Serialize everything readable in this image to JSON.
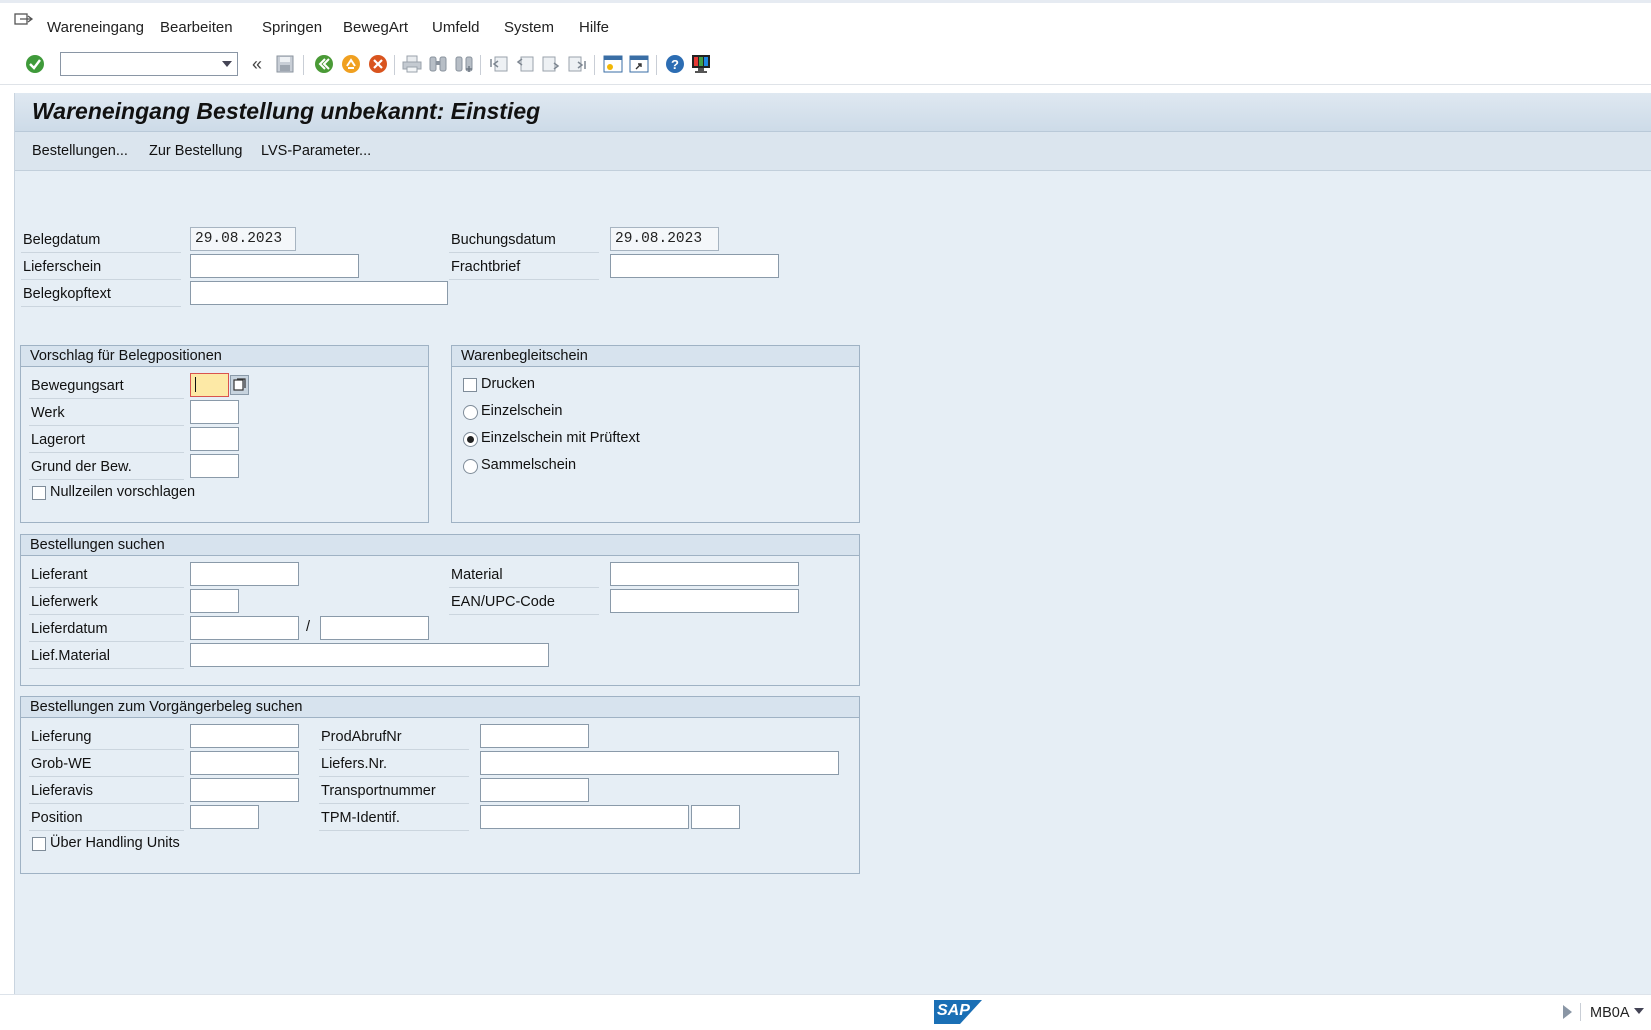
{
  "menu": {
    "items": [
      "Wareneingang",
      "Bearbeiten",
      "Springen",
      "BewegArt",
      "Umfeld",
      "System",
      "Hilfe"
    ]
  },
  "toolbar": {
    "command_value": ""
  },
  "title": "Wareneingang Bestellung unbekannt: Einstieg",
  "app_toolbar": {
    "items": [
      "Bestellungen...",
      "Zur Bestellung",
      "LVS-Parameter..."
    ]
  },
  "header": {
    "belegdatum_label": "Belegdatum",
    "belegdatum_value": "29.08.2023",
    "lieferschein_label": "Lieferschein",
    "lieferschein_value": "",
    "belegkopftext_label": "Belegkopftext",
    "belegkopftext_value": "",
    "buchungsdatum_label": "Buchungsdatum",
    "buchungsdatum_value": "29.08.2023",
    "frachtbrief_label": "Frachtbrief",
    "frachtbrief_value": ""
  },
  "vorschlag": {
    "title": "Vorschlag für Belegpositionen",
    "bewegungsart_label": "Bewegungsart",
    "bewegungsart_value": "",
    "werk_label": "Werk",
    "lagerort_label": "Lagerort",
    "grund_label": "Grund der Bew.",
    "nullzeilen_label": "Nullzeilen vorschlagen",
    "nullzeilen_checked": false
  },
  "warenbegleitschein": {
    "title": "Warenbegleitschein",
    "drucken_label": "Drucken",
    "drucken_checked": false,
    "options": [
      "Einzelschein",
      "Einzelschein mit Prüftext",
      "Sammelschein"
    ],
    "selected_option": "Einzelschein mit Prüftext"
  },
  "bestellungen_suchen": {
    "title": "Bestellungen suchen",
    "lieferant_label": "Lieferant",
    "lieferwerk_label": "Lieferwerk",
    "lieferdatum_label": "Lieferdatum",
    "lieferdatum_separator": "/",
    "liefmaterial_label": "Lief.Material",
    "material_label": "Material",
    "ean_label": "EAN/UPC-Code"
  },
  "vorgaengerbeleg": {
    "title": "Bestellungen zum Vorgängerbeleg suchen",
    "lieferung_label": "Lieferung",
    "grobwe_label": "Grob-WE",
    "lieferavis_label": "Lieferavis",
    "position_label": "Position",
    "prodabruf_label": "ProdAbrufNr",
    "liefersnr_label": "Liefers.Nr.",
    "transport_label": "Transportnummer",
    "tpm_label": "TPM-Identif.",
    "handling_label": "Über Handling Units",
    "handling_checked": false
  },
  "status": {
    "logo": "SAP",
    "transaction": "MB0A"
  },
  "colors": {
    "accent_blue": "#1a6fb5",
    "frame_bg": "#e6eef5",
    "required_field": "#fde9a6"
  }
}
